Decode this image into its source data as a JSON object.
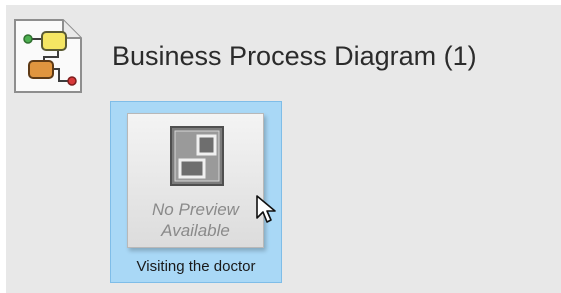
{
  "group": {
    "icon": "business-process-diagram-icon",
    "title": "Business Process Diagram (1)"
  },
  "diagram_tile": {
    "preview_icon": "diagram-preview-icon",
    "preview_line1": "No Preview",
    "preview_line2": "Available",
    "label": "Visiting the doctor",
    "selected": true,
    "selection_color": "#a9d8f6"
  },
  "cursor": {
    "icon": "mouse-pointer-icon"
  }
}
